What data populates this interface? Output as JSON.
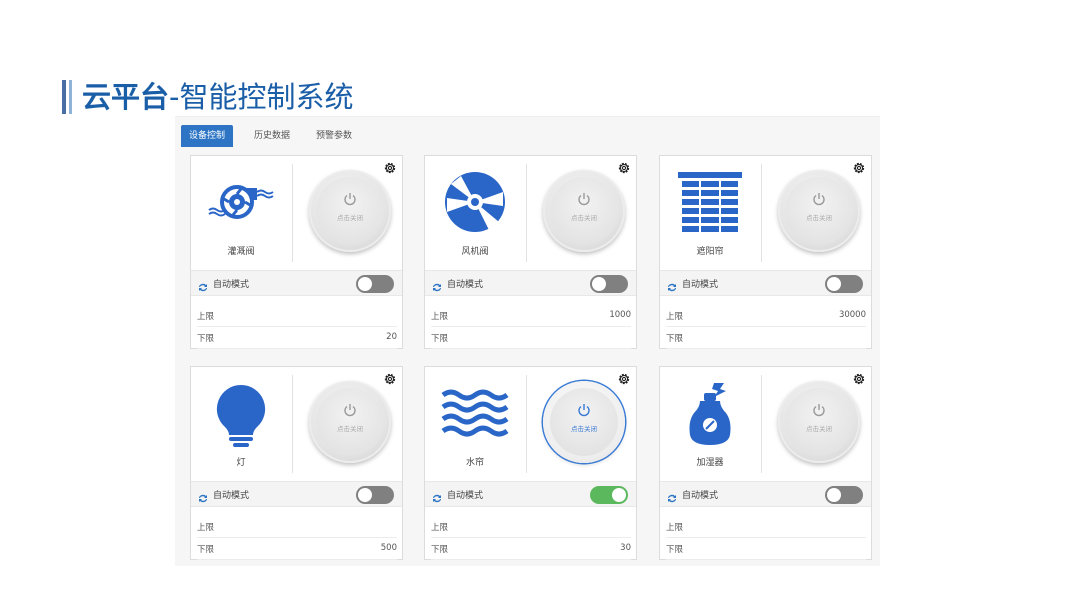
{
  "page_title": {
    "strong": "云平台",
    "light": "-智能控制系统"
  },
  "tabs": [
    {
      "label": "设备控制",
      "active": true
    },
    {
      "label": "历史数据",
      "active": false
    },
    {
      "label": "预警参数",
      "active": false
    }
  ],
  "power_label": "点击关闭",
  "mode_label": "自动模式",
  "upper_label": "上限",
  "lower_label": "下限",
  "colors": {
    "accent": "#2d75c4",
    "icon_blue": "#2a66c7",
    "toggle_on": "#5cb85c",
    "toggle_off": "#808080"
  },
  "cards": [
    {
      "name": "灌溉阀",
      "icon": "irrigation-valve-icon",
      "power_on": false,
      "auto_mode": false,
      "upper": "",
      "lower": "20"
    },
    {
      "name": "风机阀",
      "icon": "fan-icon",
      "power_on": false,
      "auto_mode": false,
      "upper": "1000",
      "lower": ""
    },
    {
      "name": "遮阳帘",
      "icon": "sunshade-blind-icon",
      "power_on": false,
      "auto_mode": false,
      "upper": "30000",
      "lower": ""
    },
    {
      "name": "灯",
      "icon": "light-bulb-icon",
      "power_on": false,
      "auto_mode": false,
      "upper": "",
      "lower": "500"
    },
    {
      "name": "水帘",
      "icon": "water-curtain-icon",
      "power_on": true,
      "auto_mode": true,
      "upper": "",
      "lower": "30"
    },
    {
      "name": "加湿器",
      "icon": "humidifier-icon",
      "power_on": false,
      "auto_mode": false,
      "upper": "",
      "lower": ""
    }
  ]
}
